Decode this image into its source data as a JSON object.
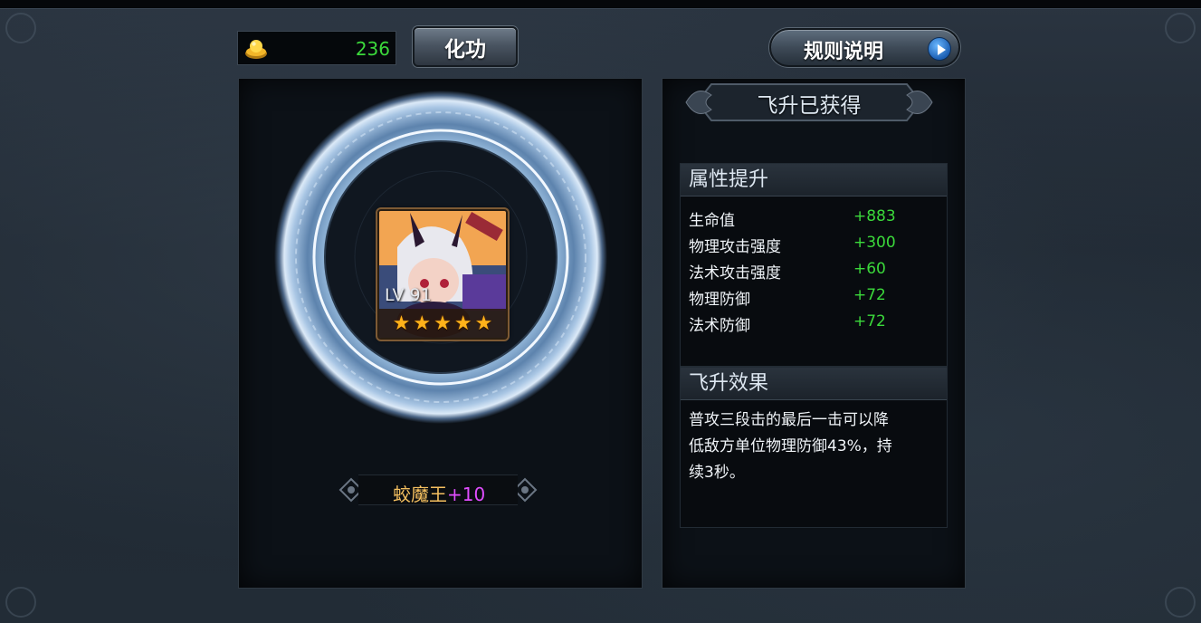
{
  "currency": {
    "icon": "gold-ingot-icon",
    "value": "236"
  },
  "buttons": {
    "huagong_label": "化功",
    "rules_label": "规则说明"
  },
  "hero": {
    "level_text": "LV 91",
    "stars": 5,
    "name": "蛟魔王",
    "plus": "+10"
  },
  "info": {
    "title": "飞升已获得",
    "attributes": {
      "heading": "属性提升",
      "rows": [
        {
          "name": "生命值",
          "value": "+883"
        },
        {
          "name": "物理攻击强度",
          "value": "+300"
        },
        {
          "name": "法术攻击强度",
          "value": "+60"
        },
        {
          "name": "物理防御",
          "value": "+72"
        },
        {
          "name": "法术防御",
          "value": "+72"
        }
      ]
    },
    "effect": {
      "heading": "飞升效果",
      "lines": [
        "普攻三段击的最后一击可以降",
        "低敌方单位物理防御43%，持",
        "续3秒。"
      ]
    }
  },
  "colors": {
    "bonus_green": "#3bd93b",
    "hero_name": "#f5c060",
    "plus_purple": "#e04dff",
    "star_gold": "#ffb21a"
  }
}
